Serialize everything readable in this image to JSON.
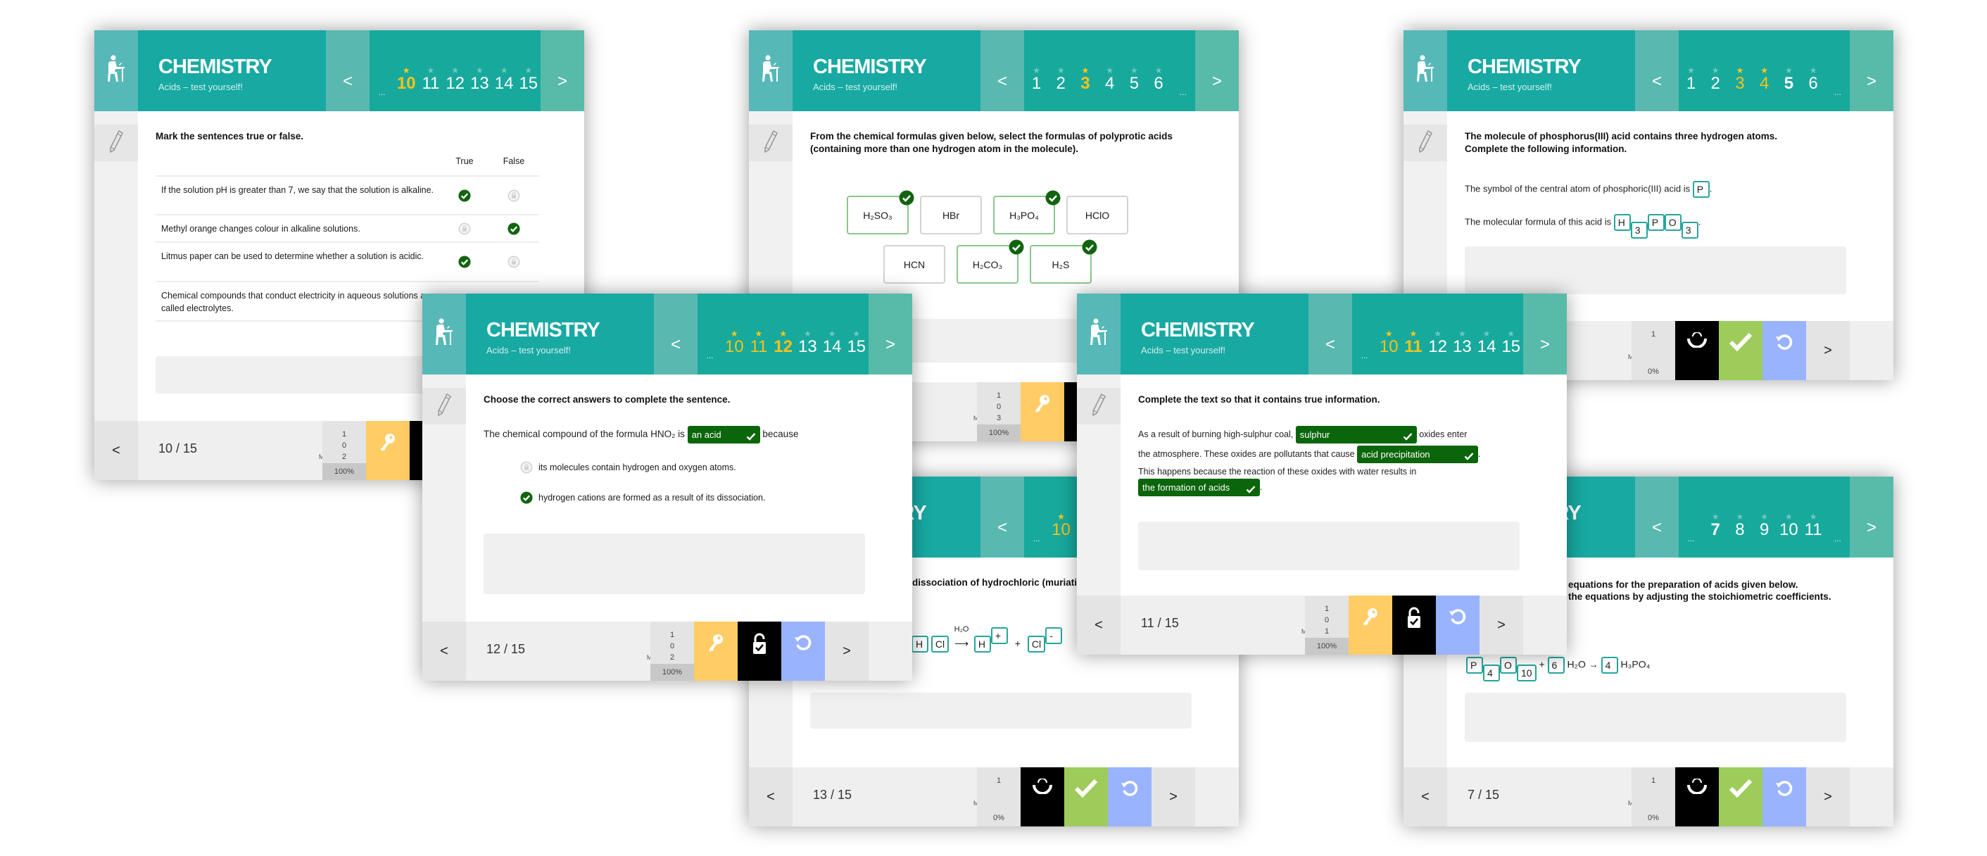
{
  "nav": {
    "prev": "<",
    "next": ">"
  },
  "labels": {
    "checks": "CHECKS:",
    "errors": "ERRORS:",
    "mistakes": "MISTAKES:",
    "result": "RESULT:"
  },
  "colors": {
    "header_teal": "#18a9a3",
    "correct_green": "#0b650b",
    "key_button": "#ffcc66",
    "check_button": "#9dcc5a",
    "reload_button": "#99b3ff",
    "star_done": "#f8c81a"
  },
  "cards": [
    {
      "header": {
        "title": "CHEMISTRY",
        "subtitle": "Acids – test yourself!",
        "pages": [
          {
            "n": "...",
            "state": "ell"
          },
          {
            "n": "10",
            "state": "cur-done"
          },
          {
            "n": "11",
            "state": "todo"
          },
          {
            "n": "12",
            "state": "todo"
          },
          {
            "n": "13",
            "state": "todo"
          },
          {
            "n": "14",
            "state": "todo"
          },
          {
            "n": "15",
            "state": "todo"
          }
        ]
      },
      "footer": {
        "page": "10 / 15",
        "checks": "1",
        "errors": "0",
        "mistakes": "2",
        "result": "100%",
        "buttons": [
          {
            "icon": "key-icon",
            "color": "#ffcc66"
          },
          {
            "icon": "lock-check-icon",
            "color": "#000000"
          },
          {
            "icon": "reload-icon",
            "color": "#99b3ff"
          }
        ]
      },
      "body": {
        "question": "Mark the sentences true or false.",
        "col_true": "True",
        "col_false": "False",
        "rows": [
          {
            "text": "If the solution pH is greater than 7, we say that the solution is alkaline.",
            "true": "checked",
            "false": "locked"
          },
          {
            "text": "Methyl orange changes colour in alkaline solutions.",
            "true": "locked",
            "false": "checked"
          },
          {
            "text": "Litmus paper can be used to determine whether a solution is acidic.",
            "true": "checked",
            "false": "locked"
          },
          {
            "text": "Chemical compounds that conduct electricity in aqueous solutions are called electrolytes."
          }
        ]
      }
    },
    {
      "header": {
        "title": "CHEMISTRY",
        "subtitle": "Acids – test yourself!",
        "pages": [
          {
            "n": "1",
            "state": "todo"
          },
          {
            "n": "2",
            "state": "todo"
          },
          {
            "n": "3",
            "state": "cur-done"
          },
          {
            "n": "4",
            "state": "todo"
          },
          {
            "n": "5",
            "state": "todo"
          },
          {
            "n": "6",
            "state": "todo"
          },
          {
            "n": "...",
            "state": "ell"
          }
        ]
      },
      "footer": {
        "page": "",
        "checks": "1",
        "errors": "0",
        "mistakes": "3",
        "result": "100%",
        "buttons": [
          {
            "icon": "key-icon",
            "color": "#ffcc66"
          },
          {
            "icon": "lock-check-icon",
            "color": "#000000"
          },
          {
            "icon": "reload-icon",
            "color": "#99b3ff"
          }
        ]
      },
      "body": {
        "question": "From the chemical formulas given below, select the formulas of polyprotic acids (containing more than one hydrogen atom in the molecule).",
        "tiles": [
          {
            "f": "H₂SO₃",
            "selected": true
          },
          {
            "f": "HBr",
            "selected": false
          },
          {
            "f": "H₃PO₄",
            "selected": true
          },
          {
            "f": "HClO",
            "selected": false
          },
          {
            "f": "HCN",
            "selected": false
          },
          {
            "f": "H₂CO₃",
            "selected": true
          },
          {
            "f": "H₂S",
            "selected": true
          }
        ]
      }
    },
    {
      "header": {
        "title": "CHEMISTRY",
        "subtitle": "Acids – test yourself!",
        "pages": [
          {
            "n": "1",
            "state": "todo"
          },
          {
            "n": "2",
            "state": "todo"
          },
          {
            "n": "3",
            "state": "done"
          },
          {
            "n": "4",
            "state": "done"
          },
          {
            "n": "5",
            "state": "cur"
          },
          {
            "n": "6",
            "state": "todo"
          },
          {
            "n": "...",
            "state": "ell"
          }
        ]
      },
      "footer": {
        "page": "",
        "checks": "1",
        "errors": "",
        "mistakes": "",
        "result": "0%",
        "buttons": [
          {
            "icon": "eye-icon",
            "color": "#000000"
          },
          {
            "icon": "check-icon",
            "color": "#9dcc5a"
          },
          {
            "icon": "reload-icon",
            "color": "#99b3ff"
          }
        ]
      },
      "body": {
        "question": "The molecule of phosphorus(III) acid contains three hydrogen atoms. Complete the following information.",
        "line1": "The symbol of the central atom of phosphoric(III) acid is",
        "line1_box": "P",
        "line2": "The molecular formula of this acid is",
        "line2_boxes": [
          "H",
          "3",
          "P",
          "O",
          "3"
        ],
        "period": "."
      }
    },
    {
      "header": {
        "title": "CHEMISTRY",
        "subtitle": "Acids – test yourself!",
        "pages": [
          {
            "n": "...",
            "state": "ell"
          },
          {
            "n": "10",
            "state": "done"
          },
          {
            "n": "11",
            "state": "done"
          },
          {
            "n": "12",
            "state": "cur-done"
          },
          {
            "n": "13",
            "state": "todo"
          },
          {
            "n": "14",
            "state": "todo"
          },
          {
            "n": "15",
            "state": "todo"
          }
        ]
      },
      "footer": {
        "page": "12 / 15",
        "checks": "1",
        "errors": "0",
        "mistakes": "2",
        "result": "100%",
        "buttons": [
          {
            "icon": "key-icon",
            "color": "#ffcc66"
          },
          {
            "icon": "lock-check-icon",
            "color": "#000000"
          },
          {
            "icon": "reload-icon",
            "color": "#99b3ff"
          }
        ]
      },
      "body": {
        "question": "Choose the correct answers to complete the sentence.",
        "before": "The chemical compound of the formula HNO₂ is",
        "dropdown": "an acid",
        "after": "because",
        "options": [
          {
            "text": "its molecules contain hydrogen and oxygen atoms.",
            "state": "locked"
          },
          {
            "text": "hydrogen cations are formed as a result of its dissociation.",
            "state": "checked"
          }
        ]
      }
    },
    {
      "header": {
        "title": "CHEMISTRY",
        "subtitle": "",
        "pages": [
          {
            "n": "...",
            "state": "ell"
          },
          {
            "n": "10",
            "state": "done"
          }
        ]
      },
      "footer": {
        "page": "13 / 15",
        "checks": "1",
        "errors": "",
        "mistakes": "",
        "result": "0%",
        "buttons": [
          {
            "icon": "eye-icon",
            "color": "#000000"
          },
          {
            "icon": "check-icon",
            "color": "#9dcc5a"
          },
          {
            "icon": "reload-icon",
            "color": "#99b3ff"
          }
        ]
      },
      "body": {
        "question_fragment": "dissociation of hydrochloric (muriatic",
        "boxes": [
          "H",
          "Cl",
          "H",
          "+",
          "Cl",
          "-"
        ],
        "over_arrow": "H₂O",
        "arrow": "⟶",
        "plus": "+"
      }
    },
    {
      "header": {
        "title": "CHEMISTRY",
        "subtitle": "Acids – test yourself!",
        "pages": [
          {
            "n": "...",
            "state": "ell"
          },
          {
            "n": "10",
            "state": "done"
          },
          {
            "n": "11",
            "state": "cur-done"
          },
          {
            "n": "12",
            "state": "todo"
          },
          {
            "n": "13",
            "state": "todo"
          },
          {
            "n": "14",
            "state": "todo"
          },
          {
            "n": "15",
            "state": "todo"
          }
        ]
      },
      "footer": {
        "page": "11 / 15",
        "checks": "1",
        "errors": "0",
        "mistakes": "1",
        "result": "100%",
        "buttons": [
          {
            "icon": "key-icon",
            "color": "#ffcc66"
          },
          {
            "icon": "lock-check-icon",
            "color": "#000000"
          },
          {
            "icon": "reload-icon",
            "color": "#99b3ff"
          }
        ]
      },
      "body": {
        "question": "Complete the text so that it contains true information.",
        "l1a": "As a result of burning high-sulphur coal,",
        "d1": "sulphur",
        "l1b": "oxides enter",
        "l2a": "the atmosphere. These oxides are pollutants that cause",
        "d2": "acid precipitation",
        "l2b": ".",
        "l3": "This happens because the reaction of these oxides with water results in",
        "d3": "the formation of acids",
        "l4b": "."
      }
    },
    {
      "header": {
        "title": "CHEMISTRY",
        "subtitle": "",
        "pages": [
          {
            "n": "...",
            "state": "ell"
          },
          {
            "n": "7",
            "state": "cur"
          },
          {
            "n": "8",
            "state": "todo"
          },
          {
            "n": "9",
            "state": "todo"
          },
          {
            "n": "10",
            "state": "todo"
          },
          {
            "n": "11",
            "state": "todo"
          },
          {
            "n": "...",
            "state": "ell"
          }
        ]
      },
      "footer": {
        "page": "7 / 15",
        "checks": "1",
        "errors": "",
        "mistakes": "",
        "result": "0%",
        "buttons": [
          {
            "icon": "eye-icon",
            "color": "#000000"
          },
          {
            "icon": "check-icon",
            "color": "#9dcc5a"
          },
          {
            "icon": "reload-icon",
            "color": "#99b3ff"
          }
        ]
      },
      "body": {
        "question_line1": "equations for the preparation of acids given below.",
        "question_line2": "the equations by adjusting the stoichiometric coefficients.",
        "boxes": [
          "P",
          "4",
          "O",
          "10",
          "6",
          "4"
        ],
        "plus": "+",
        "water": "H₂O",
        "arrow": "→",
        "product": "H₃PO₄"
      }
    }
  ]
}
